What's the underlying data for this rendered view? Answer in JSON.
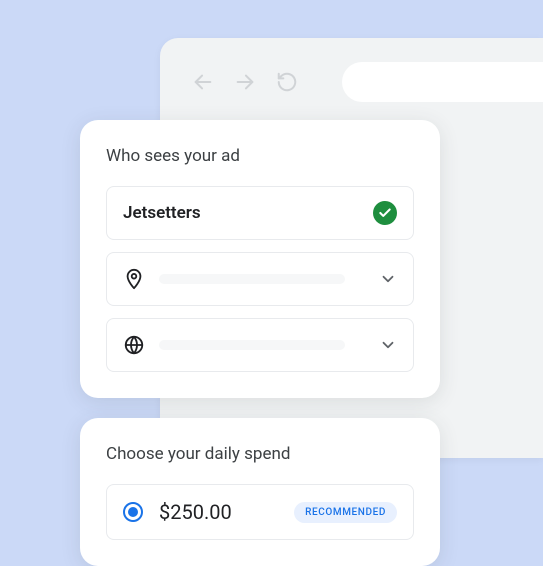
{
  "card1": {
    "title": "Who sees your ad",
    "audience_value": "Jetsetters"
  },
  "card2": {
    "title": "Choose your daily spend",
    "amount": "$250.00",
    "badge": "RECOMMENDED"
  }
}
